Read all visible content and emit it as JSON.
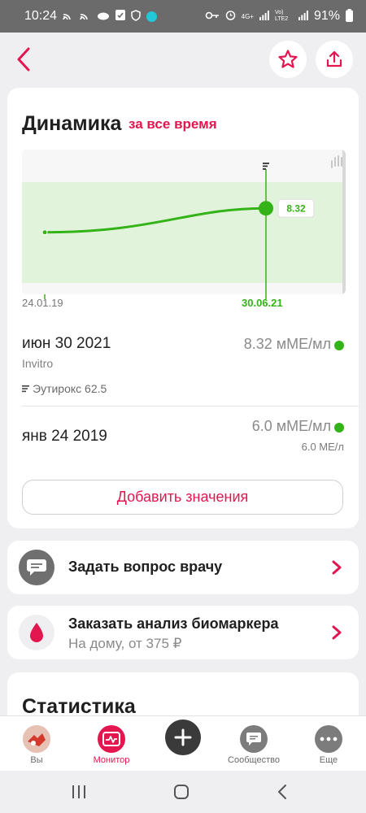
{
  "status_bar": {
    "time": "10:24",
    "battery": "91%",
    "net_top": "4G+",
    "volte": "Vo) LTE2"
  },
  "header": {
    "back_icon": "chevron-left-icon",
    "favorite_icon": "star-icon",
    "share_icon": "share-icon"
  },
  "dynamics": {
    "title": "Динамика",
    "period": "за все время",
    "chart_data": {
      "type": "line",
      "x": [
        "24.01.19",
        "30.06.21"
      ],
      "values": [
        6.0,
        8.32
      ],
      "highlight_label": "8.32",
      "tick_labels": [
        "24.01.19",
        "30.06.21"
      ]
    }
  },
  "readings": [
    {
      "date": "июн 30 2021",
      "lab": "Invitro",
      "medication": "Эутирокс 62.5",
      "value": "8.32 мМЕ/мл",
      "status_color": "#33b317"
    },
    {
      "date": "янв 24 2019",
      "value": "6.0 мМЕ/мл",
      "alt_value": "6.0 МЕ/л",
      "status_color": "#33b317"
    }
  ],
  "add_values_label": "Добавить значения",
  "ask_doctor": {
    "title": "Задать вопрос врачу",
    "icon": "chat-bubble-icon"
  },
  "order_test": {
    "title": "Заказать анализ биомаркера",
    "subtitle": "На дому, от 375 ₽",
    "icon": "blood-drop-icon"
  },
  "statistics_title": "Статистика",
  "bottom_nav": {
    "you": "Вы",
    "monitor": "Монитор",
    "community": "Сообщество",
    "more": "Еще"
  },
  "colors": {
    "accent": "#e3164f",
    "normal": "#33b317",
    "normal_band": "#e2f3dc"
  }
}
